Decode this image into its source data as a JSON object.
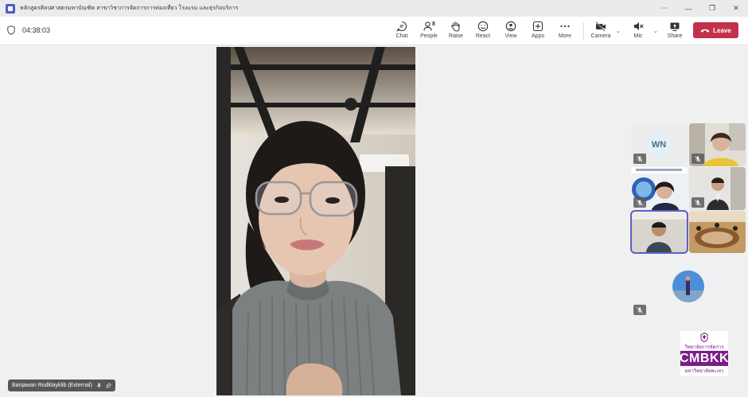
{
  "window": {
    "title": "หลักสูตรศิลปศาสตรมหาบัณฑิต สาขาวิชาการจัดการการท่องเที่ยว โรงแรม และธุรกิจบริการ",
    "controls": [
      "⋯",
      "—",
      "❐",
      "✕"
    ]
  },
  "meeting": {
    "timer": "04:38:03",
    "people_count": "8"
  },
  "toolbar": {
    "chat": "Chat",
    "people": "People",
    "raise": "Raise",
    "react": "React",
    "view": "View",
    "apps": "Apps",
    "more": "More",
    "camera": "Camera",
    "mic": "Mic",
    "share": "Share",
    "leave": "Leave"
  },
  "main_participant": {
    "name": "Banjawan Rodklayklib (External)"
  },
  "gallery": {
    "tile_wn_initials": "WN"
  },
  "logo": {
    "line1": "วิทยาลัยการจัดการ",
    "acronym": "CMBKK",
    "line2": "มหาวิทยาลัยพะเยา"
  },
  "colors": {
    "leave": "#c4314b",
    "accent": "#5b5fc7",
    "logo_purple": "#7b1c8c"
  }
}
